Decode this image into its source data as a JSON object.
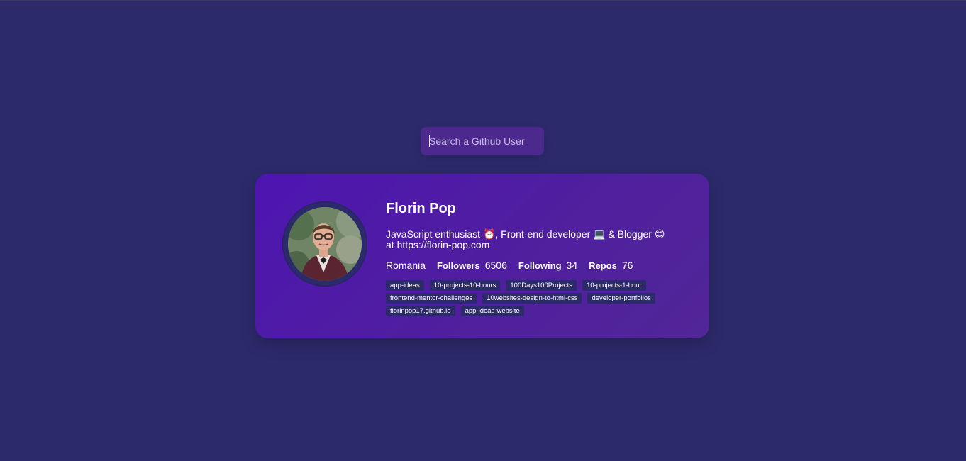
{
  "search": {
    "placeholder": "Search a Github User",
    "value": ""
  },
  "profile": {
    "name": "Florin Pop",
    "bio": "JavaScript enthusiast ⏰, Front-end developer 💻 & Blogger 😊 at https://florin-pop.com",
    "location": "Romania",
    "followers_label": "Followers",
    "followers": "6506",
    "following_label": "Following",
    "following": "34",
    "repos_label": "Repos",
    "repos_count": "76"
  },
  "repos": [
    "app-ideas",
    "10-projects-10-hours",
    "100Days100Projects",
    "10-projects-1-hour",
    "frontend-mentor-challenges",
    "10websites-design-to-html-css",
    "developer-portfolios",
    "florinpop17.github.io",
    "app-ideas-website"
  ],
  "colors": {
    "background": "#2d2a6c",
    "card_start": "#4e15b1",
    "card_end": "#512697",
    "search_bg": "#4c2a8d",
    "repo_bg": "#2c2a6b"
  },
  "icons": {
    "avatar": "user-avatar-photo"
  }
}
